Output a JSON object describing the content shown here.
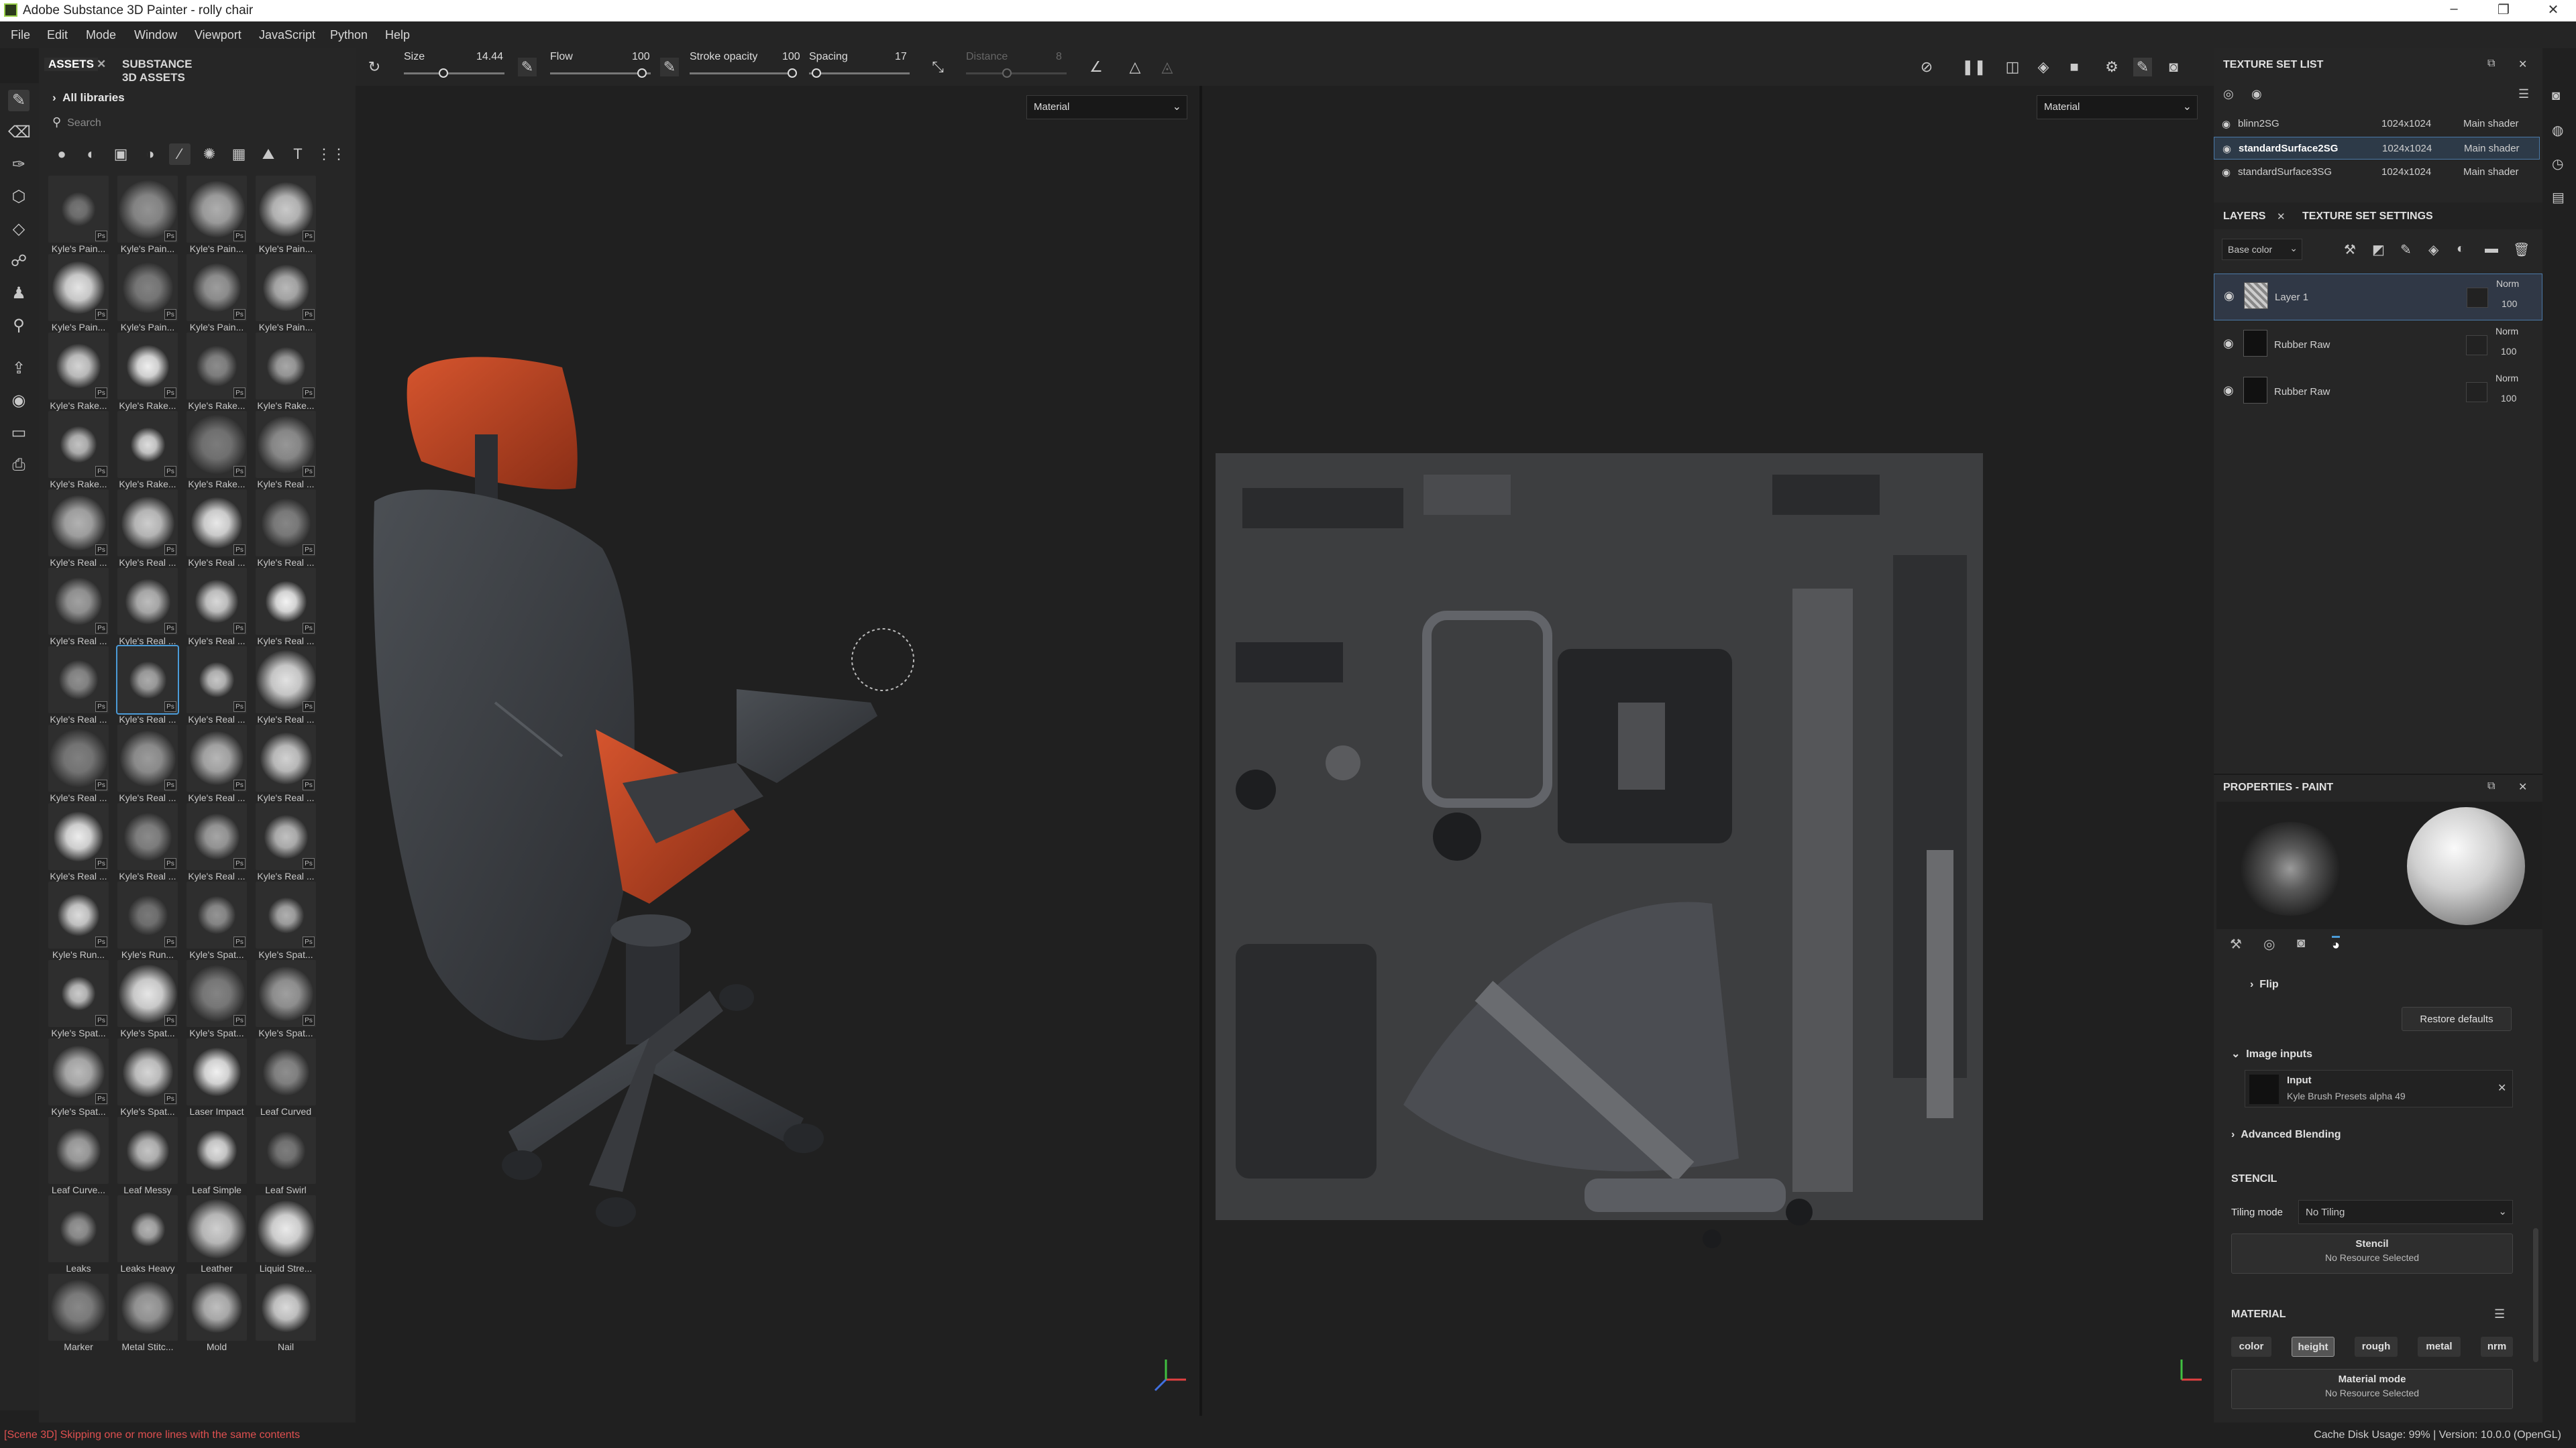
{
  "window": {
    "title": "Adobe Substance 3D Painter - rolly chair",
    "minimize": "–",
    "maximize": "❐",
    "close": "✕"
  },
  "menu": [
    "File",
    "Edit",
    "Mode",
    "Window",
    "Viewport",
    "JavaScript",
    "Python",
    "Help"
  ],
  "assets_panel": {
    "tabs": [
      "ASSETS",
      "SUBSTANCE 3D ASSETS"
    ],
    "library": "All libraries",
    "search_placeholder": "Search",
    "filter_icons": [
      "sphere-icon",
      "half-sphere-icon",
      "box-icon",
      "shade-icon",
      "brush-icon",
      "pattern-icon",
      "grid-icon",
      "image-icon",
      "text-icon",
      "apps-icon"
    ],
    "items": [
      {
        "label": "Kyle's Pain...",
        "ps": true
      },
      {
        "label": "Kyle's Pain...",
        "ps": true
      },
      {
        "label": "Kyle's Pain...",
        "ps": true
      },
      {
        "label": "Kyle's Pain...",
        "ps": true
      },
      {
        "label": "Kyle's Pain...",
        "ps": true
      },
      {
        "label": "Kyle's Pain...",
        "ps": true
      },
      {
        "label": "Kyle's Pain...",
        "ps": true
      },
      {
        "label": "Kyle's Pain...",
        "ps": true
      },
      {
        "label": "Kyle's Rake...",
        "ps": true
      },
      {
        "label": "Kyle's Rake...",
        "ps": true
      },
      {
        "label": "Kyle's Rake...",
        "ps": true
      },
      {
        "label": "Kyle's Rake...",
        "ps": true
      },
      {
        "label": "Kyle's Rake...",
        "ps": true
      },
      {
        "label": "Kyle's Rake...",
        "ps": true
      },
      {
        "label": "Kyle's Rake...",
        "ps": true
      },
      {
        "label": "Kyle's Real ...",
        "ps": true
      },
      {
        "label": "Kyle's Real ...",
        "ps": true
      },
      {
        "label": "Kyle's Real ...",
        "ps": true
      },
      {
        "label": "Kyle's Real ...",
        "ps": true
      },
      {
        "label": "Kyle's Real ...",
        "ps": true
      },
      {
        "label": "Kyle's Real ...",
        "ps": true
      },
      {
        "label": "Kyle's Real ...",
        "ps": true
      },
      {
        "label": "Kyle's Real ...",
        "ps": true
      },
      {
        "label": "Kyle's Real ...",
        "ps": true
      },
      {
        "label": "Kyle's Real ...",
        "ps": true
      },
      {
        "label": "Kyle's Real ...",
        "ps": true,
        "selected": true
      },
      {
        "label": "Kyle's Real ...",
        "ps": true
      },
      {
        "label": "Kyle's Real ...",
        "ps": true
      },
      {
        "label": "Kyle's Real ...",
        "ps": true
      },
      {
        "label": "Kyle's Real ...",
        "ps": true
      },
      {
        "label": "Kyle's Real ...",
        "ps": true
      },
      {
        "label": "Kyle's Real ...",
        "ps": true
      },
      {
        "label": "Kyle's Real ...",
        "ps": true
      },
      {
        "label": "Kyle's Real ...",
        "ps": true
      },
      {
        "label": "Kyle's Real ...",
        "ps": true
      },
      {
        "label": "Kyle's Real ...",
        "ps": true
      },
      {
        "label": "Kyle's Run...",
        "ps": true
      },
      {
        "label": "Kyle's Run...",
        "ps": true
      },
      {
        "label": "Kyle's Spat...",
        "ps": true
      },
      {
        "label": "Kyle's Spat...",
        "ps": true
      },
      {
        "label": "Kyle's Spat...",
        "ps": true
      },
      {
        "label": "Kyle's Spat...",
        "ps": true
      },
      {
        "label": "Kyle's Spat...",
        "ps": true
      },
      {
        "label": "Kyle's Spat...",
        "ps": true
      },
      {
        "label": "Kyle's Spat...",
        "ps": true
      },
      {
        "label": "Kyle's Spat...",
        "ps": true
      },
      {
        "label": "Laser Impact",
        "ps": false
      },
      {
        "label": "Leaf Curved",
        "ps": false
      },
      {
        "label": "Leaf Curve...",
        "ps": false
      },
      {
        "label": "Leaf Messy",
        "ps": false
      },
      {
        "label": "Leaf Simple",
        "ps": false
      },
      {
        "label": "Leaf Swirl",
        "ps": false
      },
      {
        "label": "Leaks",
        "ps": false
      },
      {
        "label": "Leaks Heavy",
        "ps": false
      },
      {
        "label": "Leather",
        "ps": false
      },
      {
        "label": "Liquid Stre...",
        "ps": false
      },
      {
        "label": "Marker",
        "ps": false
      },
      {
        "label": "Metal Stitc...",
        "ps": false
      },
      {
        "label": "Mold",
        "ps": false
      },
      {
        "label": "Nail",
        "ps": false
      }
    ]
  },
  "toolbar": {
    "size_label": "Size",
    "size_value": "14.44",
    "flow_label": "Flow",
    "flow_value": "100",
    "stroke_opacity_label": "Stroke opacity",
    "stroke_opacity_value": "100",
    "spacing_label": "Spacing",
    "spacing_value": "17",
    "distance_label": "Distance",
    "distance_value": "8"
  },
  "viewport": {
    "left_mode": "Material",
    "right_mode": "Material"
  },
  "texture_set_list": {
    "title": "TEXTURE SET LIST",
    "rows": [
      {
        "name": "blinn2SG",
        "size": "1024x1024",
        "shader": "Main shader"
      },
      {
        "name": "standardSurface2SG",
        "size": "1024x1024",
        "shader": "Main shader",
        "selected": true
      },
      {
        "name": "standardSurface3SG",
        "size": "1024x1024",
        "shader": "Main shader"
      }
    ]
  },
  "layers": {
    "tabs": [
      "LAYERS",
      "TEXTURE SET SETTINGS"
    ],
    "channel": "Base color",
    "items": [
      {
        "name": "Layer 1",
        "mode": "Norm",
        "opacity": "100",
        "selected": true
      },
      {
        "name": "Rubber Raw",
        "mode": "Norm",
        "opacity": "100"
      },
      {
        "name": "Rubber Raw",
        "mode": "Norm",
        "opacity": "100"
      }
    ]
  },
  "properties": {
    "title": "PROPERTIES - PAINT",
    "flip": "Flip",
    "restore": "Restore defaults",
    "image_inputs": "Image inputs",
    "input_label": "Input",
    "input_value": "Kyle Brush Presets alpha 49",
    "advanced": "Advanced Blending",
    "stencil_title": "STENCIL",
    "tiling_label": "Tiling mode",
    "tiling_value": "No Tiling",
    "stencil_btn": "Stencil",
    "stencil_res": "No Resource Selected",
    "material_title": "MATERIAL",
    "channels": [
      "color",
      "height",
      "rough",
      "metal",
      "nrm"
    ],
    "material_mode": "Material mode",
    "material_res": "No Resource Selected"
  },
  "status": {
    "message": "[Scene 3D] Skipping one or more lines with the same contents",
    "message_color": "#e05050",
    "right": "Cache Disk Usage:   99%  |  Version: 10.0.0 (OpenGL)"
  }
}
